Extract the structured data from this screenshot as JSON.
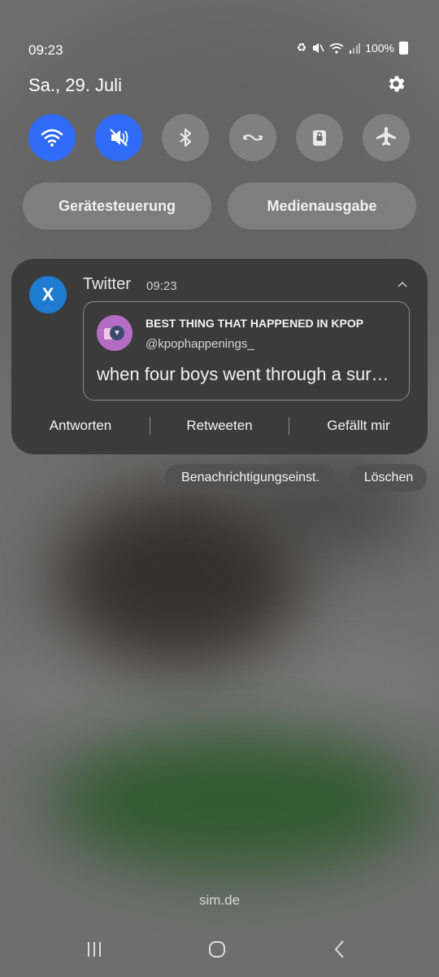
{
  "status_bar": {
    "time": "09:23",
    "battery": "100%",
    "icons": [
      "recycle-icon",
      "mute-icon",
      "wifi-icon",
      "signal-icon",
      "battery-icon"
    ]
  },
  "header": {
    "date": "Sa., 29. Juli"
  },
  "quick_settings": {
    "tiles": [
      {
        "name": "wifi",
        "active": true
      },
      {
        "name": "mute",
        "active": true
      },
      {
        "name": "bluetooth",
        "active": false
      },
      {
        "name": "auto-rotate",
        "active": false
      },
      {
        "name": "lock",
        "active": false
      },
      {
        "name": "airplane-mode",
        "active": false
      }
    ],
    "device_control": "Gerätesteuerung",
    "media_output": "Medienausgabe"
  },
  "notification": {
    "app_name": "Twitter",
    "time": "09:23",
    "app_icon_letter": "X",
    "account_name": "BEST THING THAT HAPPENED IN KPOP",
    "account_handle": "@kpophappenings_",
    "text": "when four boys went through a sur…",
    "actions": [
      "Antworten",
      "Retweeten",
      "Gefällt mir"
    ]
  },
  "notification_controls": {
    "settings": "Benachrichtigungseinst.",
    "clear": "Löschen"
  },
  "carrier": "sim.de",
  "colors": {
    "accent": "#2f6bf6",
    "twitter": "#1e7bd0"
  }
}
